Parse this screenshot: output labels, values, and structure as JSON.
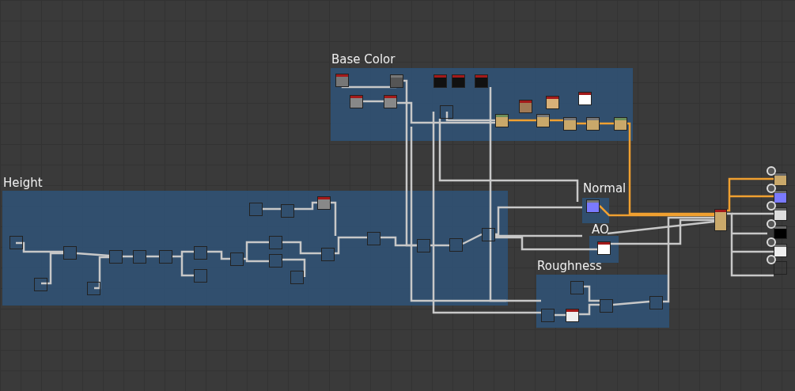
{
  "frames": [
    {
      "title": "Base Color"
    },
    {
      "title": "Height"
    },
    {
      "title": "Normal"
    },
    {
      "title": "AO"
    },
    {
      "title": "Roughness"
    }
  ]
}
